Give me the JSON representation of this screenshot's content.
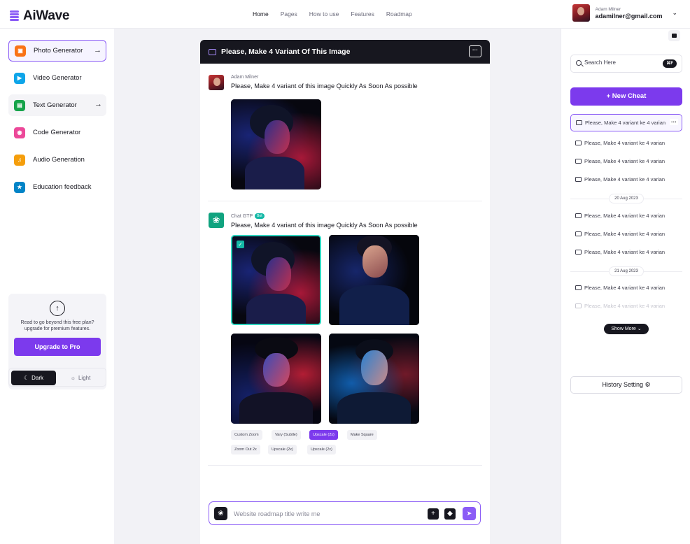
{
  "app": {
    "name": "AiWave"
  },
  "topnav": {
    "items": [
      "Home",
      "Pages",
      "How to use",
      "Features",
      "Roadmap"
    ]
  },
  "user": {
    "name": "Adam Milner",
    "email": "adamilner@gmail.com"
  },
  "sidebar": {
    "items": [
      {
        "label": "Photo Generator",
        "icon": "image-icon",
        "color": "#f97316"
      },
      {
        "label": "Video Generator",
        "icon": "play-icon",
        "color": "#0ea5e9"
      },
      {
        "label": "Text Generator",
        "icon": "document-icon",
        "color": "#16a34a"
      },
      {
        "label": "Code Generator",
        "icon": "code-icon",
        "color": "#ec4899"
      },
      {
        "label": "Audio Generation",
        "icon": "music-note-icon",
        "color": "#f59e0b"
      },
      {
        "label": "Education feedback",
        "icon": "trophy-icon",
        "color": "#0284c7"
      }
    ],
    "upgrade": {
      "text": "Read to go beyond this free plan? upgrade for premium features.",
      "button": "Upgrade to Pro"
    },
    "theme": {
      "dark": "Dark",
      "light": "Light"
    }
  },
  "chat": {
    "title": "Please, Make 4 Variant Of This Image",
    "user_message": {
      "name": "Adam Milner",
      "text": "Please, Make 4 variant of this image Quickly As Soon As possible"
    },
    "bot_message": {
      "name": "Chat GTP",
      "badge": "Bot",
      "text": "Please, Make 4 variant of this image Quickly As Soon As possible"
    },
    "actions": [
      "Custom Zoom",
      "Vary (Subtle)",
      "Upscale (2x)",
      "Make Square",
      "Zoom Out 2x",
      "Upscale (2x)",
      "Upscale (2x)"
    ],
    "input_placeholder": "Website roadmap title write me"
  },
  "history": {
    "search_placeholder": "Search Here",
    "shortcut": "⌘F",
    "new_button": "+ New Cheat",
    "item_text": "Please, Make 4 variant ke 4 varian",
    "dates": [
      "20 Aug 2023",
      "21 Aug 2023"
    ],
    "show_more": "Show More",
    "setting": "History Setting"
  },
  "colors": {
    "accent": "#7c3aed",
    "dark": "#17171f",
    "teal": "#14b8a6"
  }
}
